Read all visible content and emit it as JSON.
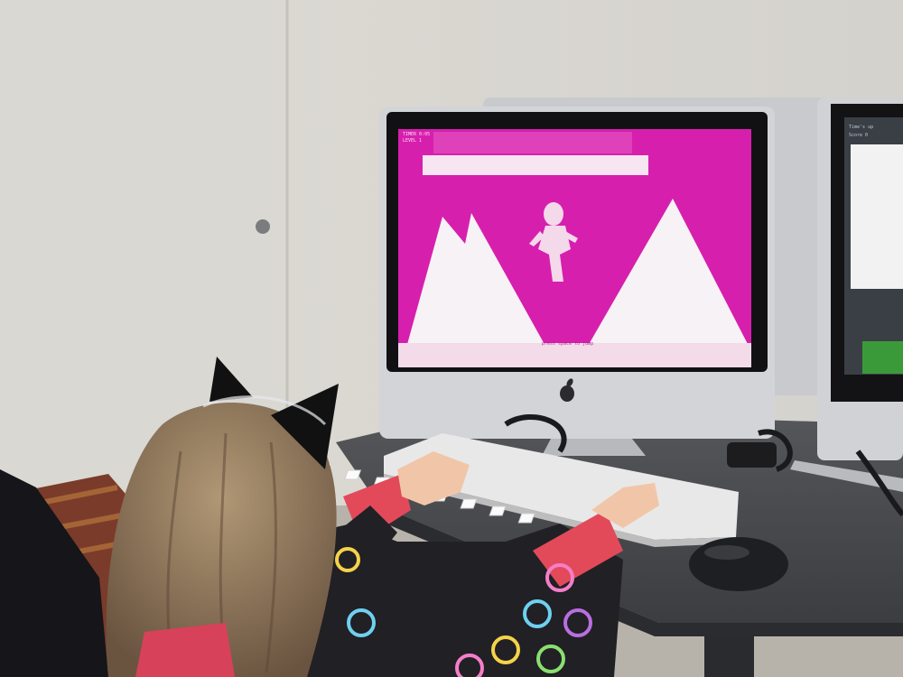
{
  "scene": {
    "description_free": true,
    "colors": {
      "wall": "#d9d6cf",
      "game_background": "#d71fae",
      "game_shapes": "#f7f2f5",
      "desk": "#4a4c50",
      "imac_silver": "#cfd1d4",
      "keyboard": "#eeeeee",
      "mouse": "#1e1f22",
      "hair": "#8a7155",
      "cat_ears": "#111111",
      "sleeve": "#e24a5a",
      "pajama": "#202025"
    },
    "game_screen": {
      "hud_line_1": "TIMER 0:05",
      "hud_line_2": "LEVEL 1",
      "footer_text": "press space to jump"
    },
    "side_screen": {
      "line_1": "Time's up",
      "line_2": "Score 0"
    }
  }
}
